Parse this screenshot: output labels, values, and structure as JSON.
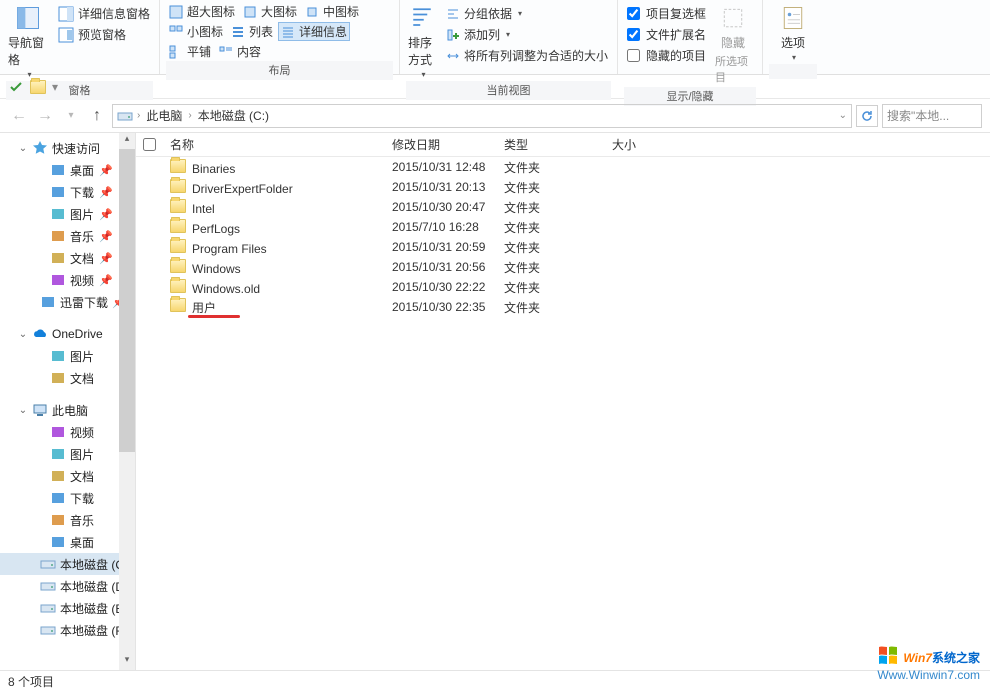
{
  "ribbon": {
    "panes": {
      "nav_pane": "导航窗格",
      "preview_pane": "预览窗格",
      "detail_pane": "详细信息窗格"
    },
    "layout": {
      "extra_large": "超大图标",
      "large": "大图标",
      "medium": "中图标",
      "small": "小图标",
      "list": "列表",
      "details": "详细信息",
      "tiles": "平铺",
      "content": "内容"
    },
    "current_view": {
      "sort_by": "排序方式",
      "group_by": "分组依据",
      "add_column": "添加列",
      "fit_columns": "将所有列调整为合适的大小"
    },
    "show_hide": {
      "item_checkboxes": "项目复选框",
      "file_extensions": "文件扩展名",
      "hidden_items": "隐藏的项目",
      "hide_selected_btn": "隐藏",
      "hide_selected_sub": "所选项目"
    },
    "options": "选项",
    "group_labels": {
      "panes": "窗格",
      "layout": "布局",
      "current_view": "当前视图",
      "show_hide": "显示/隐藏"
    },
    "checkbox_states": {
      "item_checkboxes": true,
      "file_extensions": true,
      "hidden_items": false
    }
  },
  "breadcrumb": {
    "root": "此电脑",
    "current": "本地磁盘 (C:)"
  },
  "search": {
    "placeholder": "搜索\"本地..."
  },
  "sidebar": {
    "quick_access": "快速访问",
    "quick_items": [
      {
        "label": "桌面",
        "icon": "desktop"
      },
      {
        "label": "下载",
        "icon": "download"
      },
      {
        "label": "图片",
        "icon": "pictures"
      },
      {
        "label": "音乐",
        "icon": "music"
      },
      {
        "label": "文档",
        "icon": "documents"
      },
      {
        "label": "视频",
        "icon": "videos"
      },
      {
        "label": "迅雷下载",
        "icon": "download"
      }
    ],
    "onedrive": "OneDrive",
    "onedrive_items": [
      {
        "label": "图片",
        "icon": "pictures"
      },
      {
        "label": "文档",
        "icon": "documents"
      }
    ],
    "this_pc": "此电脑",
    "this_pc_items": [
      {
        "label": "视频",
        "icon": "videos"
      },
      {
        "label": "图片",
        "icon": "pictures"
      },
      {
        "label": "文档",
        "icon": "documents"
      },
      {
        "label": "下载",
        "icon": "download"
      },
      {
        "label": "音乐",
        "icon": "music"
      },
      {
        "label": "桌面",
        "icon": "desktop"
      },
      {
        "label": "本地磁盘 (C:)",
        "icon": "drive",
        "selected": true
      },
      {
        "label": "本地磁盘 (D:)",
        "icon": "drive"
      },
      {
        "label": "本地磁盘 (E:)",
        "icon": "drive"
      },
      {
        "label": "本地磁盘 (F:)",
        "icon": "drive"
      }
    ]
  },
  "columns": {
    "name": "名称",
    "date": "修改日期",
    "type": "类型",
    "size": "大小"
  },
  "files": [
    {
      "name": "Binaries",
      "date": "2015/10/31 12:48",
      "type": "文件夹"
    },
    {
      "name": "DriverExpertFolder",
      "date": "2015/10/31 20:13",
      "type": "文件夹"
    },
    {
      "name": "Intel",
      "date": "2015/10/30 20:47",
      "type": "文件夹"
    },
    {
      "name": "PerfLogs",
      "date": "2015/7/10 16:28",
      "type": "文件夹"
    },
    {
      "name": "Program Files",
      "date": "2015/10/31 20:59",
      "type": "文件夹"
    },
    {
      "name": "Windows",
      "date": "2015/10/31 20:56",
      "type": "文件夹"
    },
    {
      "name": "Windows.old",
      "date": "2015/10/30 22:22",
      "type": "文件夹"
    },
    {
      "name": "用户",
      "date": "2015/10/30 22:35",
      "type": "文件夹",
      "highlight": true
    }
  ],
  "status": "8 个项目",
  "watermark": {
    "brand": "Win7",
    "suffix": "系统之家",
    "url": "Www.Winwin7.com"
  }
}
